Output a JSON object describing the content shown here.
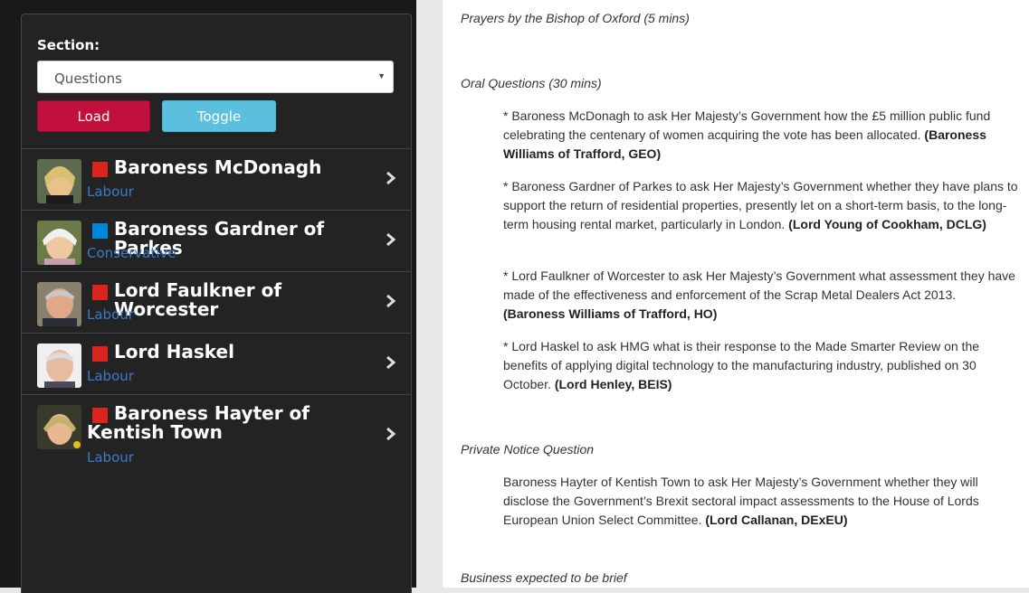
{
  "sidebar": {
    "section_label": "Section:",
    "section_select": {
      "selected": "Questions"
    },
    "load_label": "Load",
    "toggle_label": "Toggle",
    "members": [
      {
        "name": "Baroness McDonagh",
        "party": "Labour",
        "party_color": "#dc241f"
      },
      {
        "name": "Baroness Gardner of Parkes",
        "party": "Conservative",
        "party_color": "#0087dc"
      },
      {
        "name": "Lord Faulkner of Worcester",
        "party": "Labour",
        "party_color": "#dc241f"
      },
      {
        "name": "Lord Haskel",
        "party": "Labour",
        "party_color": "#dc241f"
      },
      {
        "name": "Baroness Hayter of Kentish Town",
        "party": "Labour",
        "party_color": "#dc241f"
      }
    ]
  },
  "document": {
    "prayers": "Prayers by the Bishop of Oxford (5 mins)",
    "oral_heading": "Oral Questions (30 mins)",
    "oral_questions": [
      {
        "text": "* Baroness McDonagh to ask Her Majesty’s Government how the £5 million public fund celebrating the centenary of women acquiring the vote has been allocated. ",
        "answer": "(Baroness Williams of Trafford, GEO)"
      },
      {
        "text": "* Baroness Gardner of Parkes to ask Her Majesty’s Government whether they have plans to support the return of residential properties, presently let on a short-term basis, to the long-term housing rental market, particularly in London. ",
        "answer": "(Lord Young of Cookham, DCLG)"
      },
      {
        "text": "* Lord Faulkner of Worcester to ask Her Majesty’s Government what assessment they have made of the effectiveness and enforcement of the Scrap Metal Dealers Act 2013. ",
        "answer": "(Baroness Williams of Trafford, HO)"
      },
      {
        "text": "* Lord Haskel to ask HMG what is their response to the Made Smarter Review on the benefits of applying digital technology to the manufacturing industry, published on 30 October. ",
        "answer": "(Lord Henley, BEIS)"
      }
    ],
    "pnq_heading": "Private Notice Question",
    "pnq": {
      "text": "Baroness Hayter of Kentish Town to ask Her Majesty’s Government whether they will disclose the Government’s Brexit sectoral impact assessments to the House of Lords European Union Select Committee. ",
      "answer": "(Lord Callanan, DExEU)"
    },
    "business_heading": "Business expected to be brief"
  }
}
